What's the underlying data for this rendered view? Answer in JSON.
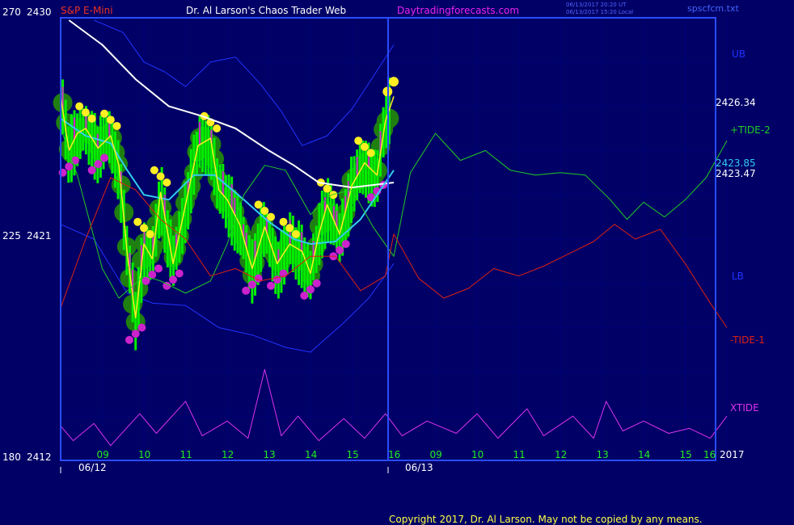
{
  "header": {
    "instrument": "S&P E-Mini",
    "site_title": "Dr. Al Larson's Chaos Trader Web",
    "site_url": "Daytradingforecasts.com",
    "timestamp_ut": "06/13/2017 20:20 UT",
    "timestamp_local": "06/13/2017 15:20 Local",
    "file_name": "spscfcm.txt"
  },
  "footer": {
    "copyright": "Copyright 2017, Dr. Al Larson. May not be copied by any means."
  },
  "colors": {
    "background": "#000066",
    "grid": "#00007a",
    "frame": "#2a4cff",
    "price_bar": "#00ee00",
    "glow": "#1f7f10",
    "yellow": "#ffee22",
    "magenta": "#cc22cc",
    "white_ma": "#ffffff",
    "cyan_ma": "#33ccee",
    "band": "#2233ff",
    "tide2": "#22cc22",
    "tide1": "#dd2211",
    "xtide": "#dd33ee"
  },
  "chart_data": {
    "type": "line",
    "ylabel_left_outer": [
      "270",
      "225",
      "180"
    ],
    "ylabel_left_inner": [
      "2430",
      "2421",
      "2412"
    ],
    "ylim": [
      2412,
      2430
    ],
    "x_ticks_day1": [
      "09",
      "10",
      "11",
      "12",
      "13",
      "14",
      "15",
      "16"
    ],
    "x_ticks_day2": [
      "09",
      "10",
      "11",
      "12",
      "13",
      "14",
      "15",
      "16"
    ],
    "dates": [
      "06/12",
      "06/13"
    ],
    "year": "2017",
    "right_labels": {
      "ub": "UB",
      "tide2": "+TIDE-2",
      "lb": "LB",
      "tide1": "-TIDE-1",
      "xtide": "XTIDE"
    },
    "price_labels": [
      "2426.34",
      "2423.85",
      "2423.47"
    ],
    "price_close": [
      {
        "x": 0.0,
        "y": 2426.8
      },
      {
        "x": 0.2,
        "y": 2424.6
      },
      {
        "x": 0.4,
        "y": 2425.3
      },
      {
        "x": 0.6,
        "y": 2425.5
      },
      {
        "x": 0.9,
        "y": 2424.7
      },
      {
        "x": 1.2,
        "y": 2425.2
      },
      {
        "x": 1.4,
        "y": 2424.0
      },
      {
        "x": 1.6,
        "y": 2420.4
      },
      {
        "x": 1.8,
        "y": 2417.8
      },
      {
        "x": 2.0,
        "y": 2420.8
      },
      {
        "x": 2.2,
        "y": 2420.2
      },
      {
        "x": 2.4,
        "y": 2422.9
      },
      {
        "x": 2.7,
        "y": 2420.0
      },
      {
        "x": 3.0,
        "y": 2422.4
      },
      {
        "x": 3.3,
        "y": 2424.8
      },
      {
        "x": 3.6,
        "y": 2425.1
      },
      {
        "x": 3.8,
        "y": 2423.0
      },
      {
        "x": 4.0,
        "y": 2422.6
      },
      {
        "x": 4.3,
        "y": 2421.6
      },
      {
        "x": 4.6,
        "y": 2419.8
      },
      {
        "x": 4.9,
        "y": 2421.5
      },
      {
        "x": 5.2,
        "y": 2420.0
      },
      {
        "x": 5.5,
        "y": 2420.8
      },
      {
        "x": 5.8,
        "y": 2420.5
      },
      {
        "x": 6.0,
        "y": 2419.6
      },
      {
        "x": 6.2,
        "y": 2421.2
      },
      {
        "x": 6.4,
        "y": 2422.4
      },
      {
        "x": 6.7,
        "y": 2421.2
      },
      {
        "x": 7.0,
        "y": 2423.2
      },
      {
        "x": 7.3,
        "y": 2424.1
      },
      {
        "x": 7.6,
        "y": 2423.6
      },
      {
        "x": 7.8,
        "y": 2425.8
      },
      {
        "x": 8.0,
        "y": 2426.8
      }
    ],
    "ma_white": [
      {
        "x": 0.2,
        "y": 2429.9
      },
      {
        "x": 1.0,
        "y": 2428.9
      },
      {
        "x": 1.8,
        "y": 2427.5
      },
      {
        "x": 2.6,
        "y": 2426.4
      },
      {
        "x": 3.4,
        "y": 2426.0
      },
      {
        "x": 4.2,
        "y": 2425.5
      },
      {
        "x": 5.0,
        "y": 2424.6
      },
      {
        "x": 5.6,
        "y": 2424.0
      },
      {
        "x": 6.2,
        "y": 2423.3
      },
      {
        "x": 7.0,
        "y": 2423.1
      },
      {
        "x": 8.0,
        "y": 2423.3
      }
    ],
    "ma_cyan": [
      {
        "x": 0.0,
        "y": 2425.9
      },
      {
        "x": 0.6,
        "y": 2425.2
      },
      {
        "x": 1.2,
        "y": 2424.9
      },
      {
        "x": 1.6,
        "y": 2423.8
      },
      {
        "x": 2.0,
        "y": 2422.8
      },
      {
        "x": 2.6,
        "y": 2422.6
      },
      {
        "x": 3.2,
        "y": 2423.6
      },
      {
        "x": 3.7,
        "y": 2423.6
      },
      {
        "x": 4.4,
        "y": 2422.6
      },
      {
        "x": 5.0,
        "y": 2421.7
      },
      {
        "x": 5.6,
        "y": 2421.0
      },
      {
        "x": 6.0,
        "y": 2420.8
      },
      {
        "x": 6.6,
        "y": 2420.9
      },
      {
        "x": 7.2,
        "y": 2421.8
      },
      {
        "x": 7.6,
        "y": 2422.8
      },
      {
        "x": 8.0,
        "y": 2423.8
      }
    ],
    "band_upper": [
      {
        "x": 0.8,
        "y": 2429.9
      },
      {
        "x": 1.5,
        "y": 2429.4
      },
      {
        "x": 2.0,
        "y": 2428.2
      },
      {
        "x": 2.5,
        "y": 2427.8
      },
      {
        "x": 3.0,
        "y": 2427.2
      },
      {
        "x": 3.6,
        "y": 2428.2
      },
      {
        "x": 4.2,
        "y": 2428.4
      },
      {
        "x": 4.8,
        "y": 2427.3
      },
      {
        "x": 5.3,
        "y": 2426.2
      },
      {
        "x": 5.8,
        "y": 2424.8
      },
      {
        "x": 6.4,
        "y": 2425.2
      },
      {
        "x": 7.0,
        "y": 2426.3
      },
      {
        "x": 7.5,
        "y": 2427.6
      },
      {
        "x": 8.0,
        "y": 2428.9
      }
    ],
    "band_lower": [
      {
        "x": 0.0,
        "y": 2421.6
      },
      {
        "x": 0.8,
        "y": 2421.0
      },
      {
        "x": 1.6,
        "y": 2418.8
      },
      {
        "x": 2.2,
        "y": 2418.4
      },
      {
        "x": 3.0,
        "y": 2418.3
      },
      {
        "x": 3.8,
        "y": 2417.4
      },
      {
        "x": 4.6,
        "y": 2417.1
      },
      {
        "x": 5.4,
        "y": 2416.6
      },
      {
        "x": 6.0,
        "y": 2416.4
      },
      {
        "x": 6.8,
        "y": 2417.6
      },
      {
        "x": 7.4,
        "y": 2418.6
      },
      {
        "x": 8.0,
        "y": 2420.0
      }
    ],
    "tide2": [
      {
        "x": 0.0,
        "y": 2425.5
      },
      {
        "x": 0.4,
        "y": 2423.6
      },
      {
        "x": 1.0,
        "y": 2419.8
      },
      {
        "x": 1.4,
        "y": 2418.6
      },
      {
        "x": 2.0,
        "y": 2419.5
      },
      {
        "x": 2.4,
        "y": 2419.3
      },
      {
        "x": 3.0,
        "y": 2418.8
      },
      {
        "x": 3.6,
        "y": 2419.3
      },
      {
        "x": 4.0,
        "y": 2420.8
      },
      {
        "x": 4.4,
        "y": 2422.8
      },
      {
        "x": 4.9,
        "y": 2424.0
      },
      {
        "x": 5.4,
        "y": 2423.8
      },
      {
        "x": 6.0,
        "y": 2422.0
      },
      {
        "x": 6.5,
        "y": 2422.8
      },
      {
        "x": 7.0,
        "y": 2423.0
      },
      {
        "x": 7.5,
        "y": 2421.5
      },
      {
        "x": 8.0,
        "y": 2420.3
      },
      {
        "x": 8.4,
        "y": 2423.7
      },
      {
        "x": 9.0,
        "y": 2425.3
      },
      {
        "x": 9.6,
        "y": 2424.2
      },
      {
        "x": 10.2,
        "y": 2424.6
      },
      {
        "x": 10.8,
        "y": 2423.8
      },
      {
        "x": 11.4,
        "y": 2423.6
      },
      {
        "x": 12.0,
        "y": 2423.7
      },
      {
        "x": 12.6,
        "y": 2423.6
      },
      {
        "x": 13.2,
        "y": 2422.6
      },
      {
        "x": 13.6,
        "y": 2421.8
      },
      {
        "x": 14.0,
        "y": 2422.5
      },
      {
        "x": 14.5,
        "y": 2421.9
      },
      {
        "x": 15.0,
        "y": 2422.6
      },
      {
        "x": 15.5,
        "y": 2423.5
      },
      {
        "x": 16.0,
        "y": 2425.0
      }
    ],
    "tide1": [
      {
        "x": 0.0,
        "y": 2418.2
      },
      {
        "x": 0.6,
        "y": 2421.0
      },
      {
        "x": 1.2,
        "y": 2423.5
      },
      {
        "x": 1.8,
        "y": 2423.0
      },
      {
        "x": 2.4,
        "y": 2421.8
      },
      {
        "x": 3.0,
        "y": 2421.0
      },
      {
        "x": 3.6,
        "y": 2419.5
      },
      {
        "x": 4.2,
        "y": 2419.8
      },
      {
        "x": 4.8,
        "y": 2419.3
      },
      {
        "x": 5.4,
        "y": 2419.5
      },
      {
        "x": 6.0,
        "y": 2420.3
      },
      {
        "x": 6.6,
        "y": 2420.3
      },
      {
        "x": 7.2,
        "y": 2418.9
      },
      {
        "x": 7.8,
        "y": 2419.5
      },
      {
        "x": 8.0,
        "y": 2421.2
      },
      {
        "x": 8.6,
        "y": 2419.4
      },
      {
        "x": 9.2,
        "y": 2418.6
      },
      {
        "x": 9.8,
        "y": 2419.0
      },
      {
        "x": 10.4,
        "y": 2419.8
      },
      {
        "x": 11.0,
        "y": 2419.5
      },
      {
        "x": 11.6,
        "y": 2419.9
      },
      {
        "x": 12.2,
        "y": 2420.4
      },
      {
        "x": 12.8,
        "y": 2420.9
      },
      {
        "x": 13.3,
        "y": 2421.6
      },
      {
        "x": 13.8,
        "y": 2421.0
      },
      {
        "x": 14.4,
        "y": 2421.4
      },
      {
        "x": 15.0,
        "y": 2420.0
      },
      {
        "x": 15.6,
        "y": 2418.4
      },
      {
        "x": 16.0,
        "y": 2417.4
      }
    ],
    "xtide": [
      {
        "x": 0.0,
        "y": 2413.4
      },
      {
        "x": 0.3,
        "y": 2412.8
      },
      {
        "x": 0.8,
        "y": 2413.5
      },
      {
        "x": 1.2,
        "y": 2412.6
      },
      {
        "x": 1.9,
        "y": 2413.9
      },
      {
        "x": 2.3,
        "y": 2413.1
      },
      {
        "x": 3.0,
        "y": 2414.4
      },
      {
        "x": 3.4,
        "y": 2413.0
      },
      {
        "x": 4.0,
        "y": 2413.6
      },
      {
        "x": 4.5,
        "y": 2412.9
      },
      {
        "x": 4.9,
        "y": 2415.7
      },
      {
        "x": 5.3,
        "y": 2413.0
      },
      {
        "x": 5.7,
        "y": 2413.8
      },
      {
        "x": 6.2,
        "y": 2412.8
      },
      {
        "x": 6.8,
        "y": 2413.7
      },
      {
        "x": 7.3,
        "y": 2412.9
      },
      {
        "x": 7.8,
        "y": 2413.9
      },
      {
        "x": 8.2,
        "y": 2413.0
      },
      {
        "x": 8.8,
        "y": 2413.6
      },
      {
        "x": 9.5,
        "y": 2413.1
      },
      {
        "x": 10.0,
        "y": 2413.9
      },
      {
        "x": 10.5,
        "y": 2412.9
      },
      {
        "x": 11.2,
        "y": 2414.1
      },
      {
        "x": 11.6,
        "y": 2413.0
      },
      {
        "x": 12.3,
        "y": 2413.8
      },
      {
        "x": 12.8,
        "y": 2412.9
      },
      {
        "x": 13.1,
        "y": 2414.4
      },
      {
        "x": 13.5,
        "y": 2413.2
      },
      {
        "x": 14.0,
        "y": 2413.6
      },
      {
        "x": 14.6,
        "y": 2413.1
      },
      {
        "x": 15.1,
        "y": 2413.3
      },
      {
        "x": 15.6,
        "y": 2412.9
      },
      {
        "x": 16.0,
        "y": 2413.8
      }
    ]
  }
}
